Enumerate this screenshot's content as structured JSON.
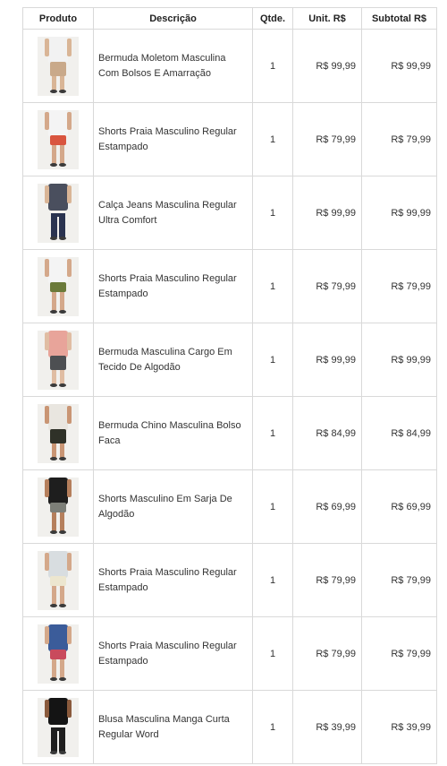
{
  "table": {
    "headers": {
      "product": "Produto",
      "description": "Descrição",
      "qty": "Qtde.",
      "unit": "Unit. R$",
      "subtotal": "Subtotal R$"
    },
    "rows": [
      {
        "description": "Bermuda Moletom Masculina Com Bolsos E Amarração",
        "qty": "1",
        "unit": "R$ 99,99",
        "subtotal": "R$ 99,99",
        "image": "product-photo",
        "shirt": "#f2f2f2",
        "bottom": "#c9a98a",
        "legs": "long-shorts",
        "skin": "#d9b596"
      },
      {
        "description": "Shorts Praia Masculino Regular Estampado",
        "qty": "1",
        "unit": "R$ 79,99",
        "subtotal": "R$ 79,99",
        "image": "product-photo",
        "shirt": "#f4f4f4",
        "bottom": "#d9553f",
        "legs": "short",
        "skin": "#d4a88a"
      },
      {
        "description": "Calça Jeans Masculina Regular Ultra Comfort",
        "qty": "1",
        "unit": "R$ 99,99",
        "subtotal": "R$ 99,99",
        "image": "product-photo",
        "shirt": "#4a4f5e",
        "bottom": "#2a3350",
        "legs": "pants",
        "skin": "#d9b596"
      },
      {
        "description": "Shorts Praia Masculino Regular Estampado",
        "qty": "1",
        "unit": "R$ 79,99",
        "subtotal": "R$ 79,99",
        "image": "product-photo",
        "shirt": "#f4f4f4",
        "bottom": "#6b7a3a",
        "legs": "short",
        "skin": "#d4a88a"
      },
      {
        "description": "Bermuda Masculina Cargo Em Tecido De Algodão",
        "qty": "1",
        "unit": "R$ 99,99",
        "subtotal": "R$ 99,99",
        "image": "product-photo",
        "shirt": "#e8a49a",
        "bottom": "#4d4f52",
        "legs": "long-shorts",
        "skin": "#e0bda3"
      },
      {
        "description": "Bermuda Chino Masculina Bolso Faca",
        "qty": "1",
        "unit": "R$ 84,99",
        "subtotal": "R$ 84,99",
        "image": "product-photo",
        "shirt": "#e9e6e0",
        "bottom": "#2f3128",
        "legs": "long-shorts",
        "skin": "#c99574"
      },
      {
        "description": "Shorts Masculino Em Sarja De Algodão",
        "qty": "1",
        "unit": "R$ 69,99",
        "subtotal": "R$ 69,99",
        "image": "product-photo",
        "shirt": "#1e1e1e",
        "bottom": "#7d7f78",
        "legs": "short",
        "skin": "#b57f5c"
      },
      {
        "description": "Shorts Praia Masculino Regular Estampado",
        "qty": "1",
        "unit": "R$ 79,99",
        "subtotal": "R$ 79,99",
        "image": "product-photo",
        "shirt": "#d8dde0",
        "bottom": "#ece6cf",
        "legs": "short",
        "skin": "#d4a88a"
      },
      {
        "description": "Shorts Praia Masculino Regular Estampado",
        "qty": "1",
        "unit": "R$ 79,99",
        "subtotal": "R$ 79,99",
        "image": "product-photo",
        "shirt": "#3b5c9a",
        "bottom": "#c94a5d",
        "legs": "short",
        "skin": "#d4a88a"
      },
      {
        "description": "Blusa Masculina Manga Curta Regular Word",
        "qty": "1",
        "unit": "R$ 39,99",
        "subtotal": "R$ 39,99",
        "image": "product-photo",
        "shirt": "#141414",
        "bottom": "#1e1e1e",
        "legs": "pants",
        "skin": "#8a5a3c"
      }
    ]
  }
}
